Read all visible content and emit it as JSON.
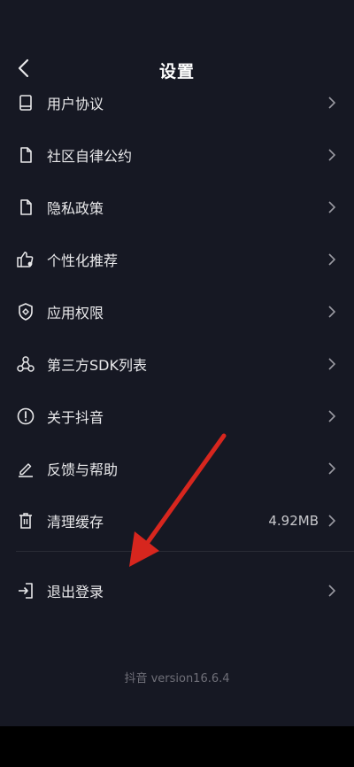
{
  "header": {
    "title": "设置",
    "back_icon": "chevron-left-icon"
  },
  "items": [
    {
      "key": "user-agreement",
      "label": "用户协议",
      "icon": "book-icon"
    },
    {
      "key": "community",
      "label": "社区自律公约",
      "icon": "document-icon"
    },
    {
      "key": "privacy",
      "label": "隐私政策",
      "icon": "document-icon"
    },
    {
      "key": "personalized",
      "label": "个性化推荐",
      "icon": "thumbs-up-icon"
    },
    {
      "key": "permissions",
      "label": "应用权限",
      "icon": "shield-icon"
    },
    {
      "key": "sdk-list",
      "label": "第三方SDK列表",
      "icon": "sdk-icon"
    },
    {
      "key": "about",
      "label": "关于抖音",
      "icon": "info-icon"
    },
    {
      "key": "feedback",
      "label": "反馈与帮助",
      "icon": "edit-icon"
    },
    {
      "key": "clear-cache",
      "label": "清理缓存",
      "icon": "trash-icon",
      "value": "4.92MB"
    }
  ],
  "logout": {
    "label": "退出登录",
    "icon": "logout-icon"
  },
  "footer": {
    "version": "抖音 version16.6.4"
  },
  "colors": {
    "background": "#161823",
    "text": "#e8e8ea",
    "annotation_arrow": "#d7261e"
  }
}
